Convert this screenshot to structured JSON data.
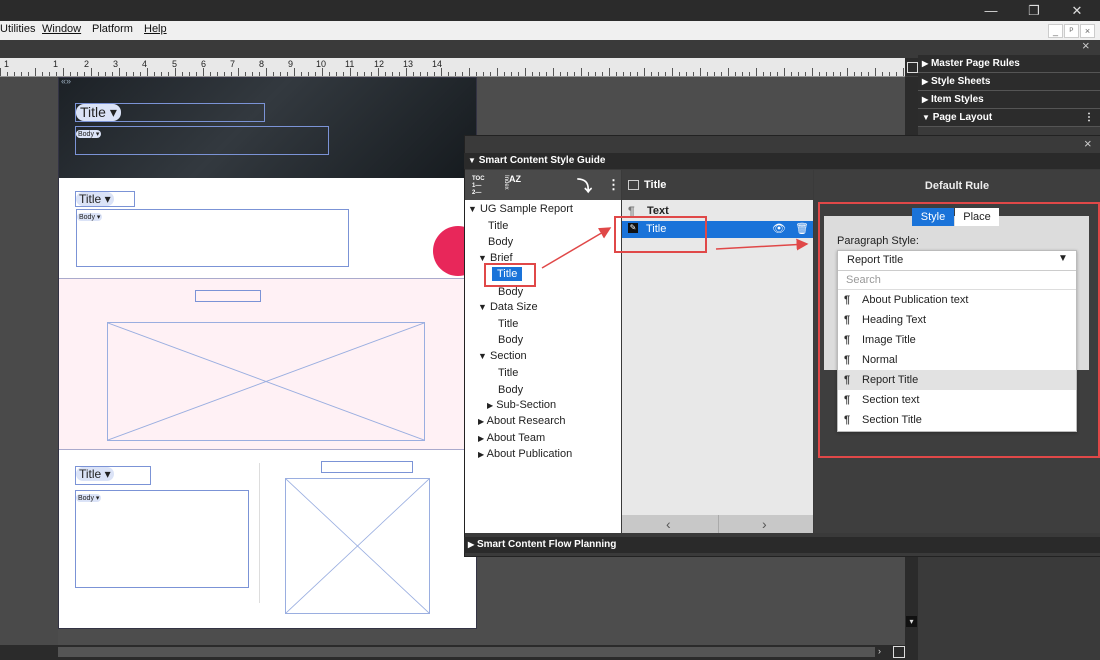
{
  "menu": {
    "items": [
      "Utilities",
      "Window",
      "Platform",
      "Help"
    ]
  },
  "window_controls": {
    "minimize": "—",
    "restore": "❐",
    "close": "✕"
  },
  "mdi_controls": {
    "minimize": "_",
    "restore": "ᴾ",
    "close": "×"
  },
  "ruler": {
    "labels": [
      "1",
      "",
      "1",
      "2",
      "3",
      "4",
      "5",
      "6",
      "7",
      "8",
      "9",
      "10",
      "11",
      "12",
      "13",
      "14"
    ]
  },
  "page": {
    "collapse": "«»",
    "title_chip": "Title",
    "body_chip": "Body",
    "dropdown_glyph": "▾"
  },
  "right_panel": {
    "close": "×",
    "items": [
      {
        "label": "Master Page Rules",
        "arrow": "▶"
      },
      {
        "label": "Style Sheets",
        "arrow": "▶"
      },
      {
        "label": "Item Styles",
        "arrow": "▶"
      },
      {
        "label": "Page Layout",
        "arrow": "▼"
      }
    ]
  },
  "style_guide": {
    "title": "Smart Content Style Guide",
    "arrow": "▼",
    "close": "×",
    "toolbar": {
      "toc": "TOC",
      "index": "Index",
      "az": "AZ"
    },
    "tree": [
      {
        "label": "UG Sample Report",
        "arrow": "▼"
      },
      {
        "label": "Title"
      },
      {
        "label": "Body"
      },
      {
        "label": "Brief",
        "arrow": "▼"
      },
      {
        "label": "Title"
      },
      {
        "label": "Body"
      },
      {
        "label": "Data Size",
        "arrow": "▼"
      },
      {
        "label": "Title"
      },
      {
        "label": "Body"
      },
      {
        "label": "Section",
        "arrow": "▼"
      },
      {
        "label": "Title"
      },
      {
        "label": "Body"
      },
      {
        "label": "Sub-Section",
        "arrow": "▶"
      },
      {
        "label": "About Research",
        "arrow": "▶"
      },
      {
        "label": "About Team",
        "arrow": "▶"
      },
      {
        "label": "About Publication",
        "arrow": "▶"
      }
    ],
    "mid": {
      "header": "Title",
      "items": [
        {
          "label": "Text",
          "icon": "¶"
        },
        {
          "label": "Title",
          "icon": "✎"
        }
      ],
      "nav_prev": "‹",
      "nav_next": "›"
    },
    "rule": {
      "header": "Default Rule",
      "tabs": [
        "Style",
        "Place"
      ],
      "paragraph_label": "Paragraph Style:",
      "selected": "Report Title",
      "search_placeholder": "Search",
      "options": [
        "About Publication text",
        "Heading Text",
        "Image Title",
        "Normal",
        "Report Title",
        "Section text",
        "Section Title"
      ]
    },
    "flow": {
      "title": "Smart Content Flow Planning",
      "arrow": "▶"
    }
  },
  "colors": {
    "accent": "#1a73d9",
    "highlight_red": "#e04848"
  }
}
